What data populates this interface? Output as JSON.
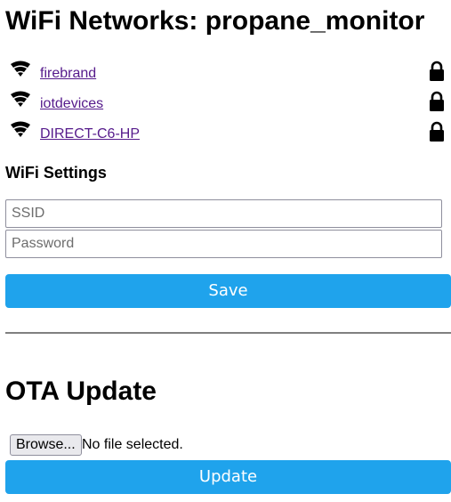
{
  "title": "WiFi Networks: propane_monitor",
  "networks": [
    {
      "ssid": "firebrand",
      "icon": "wifi-signal-icon",
      "secured_icon": "lock-icon"
    },
    {
      "ssid": "iotdevices",
      "icon": "wifi-signal-icon",
      "secured_icon": "lock-icon"
    },
    {
      "ssid": "DIRECT-C6-HP",
      "icon": "wifi-signal-icon",
      "secured_icon": "lock-icon"
    }
  ],
  "wifi_settings": {
    "heading": "WiFi Settings",
    "ssid_placeholder": "SSID",
    "ssid_value": "",
    "password_placeholder": "Password",
    "password_value": "",
    "save_label": "Save"
  },
  "ota": {
    "heading": "OTA Update",
    "browse_label": "Browse...",
    "file_status": "No file selected.",
    "update_label": "Update"
  },
  "colors": {
    "button_bg": "#1fa3ec",
    "button_text": "#ffffff",
    "link": "#551a8b"
  }
}
